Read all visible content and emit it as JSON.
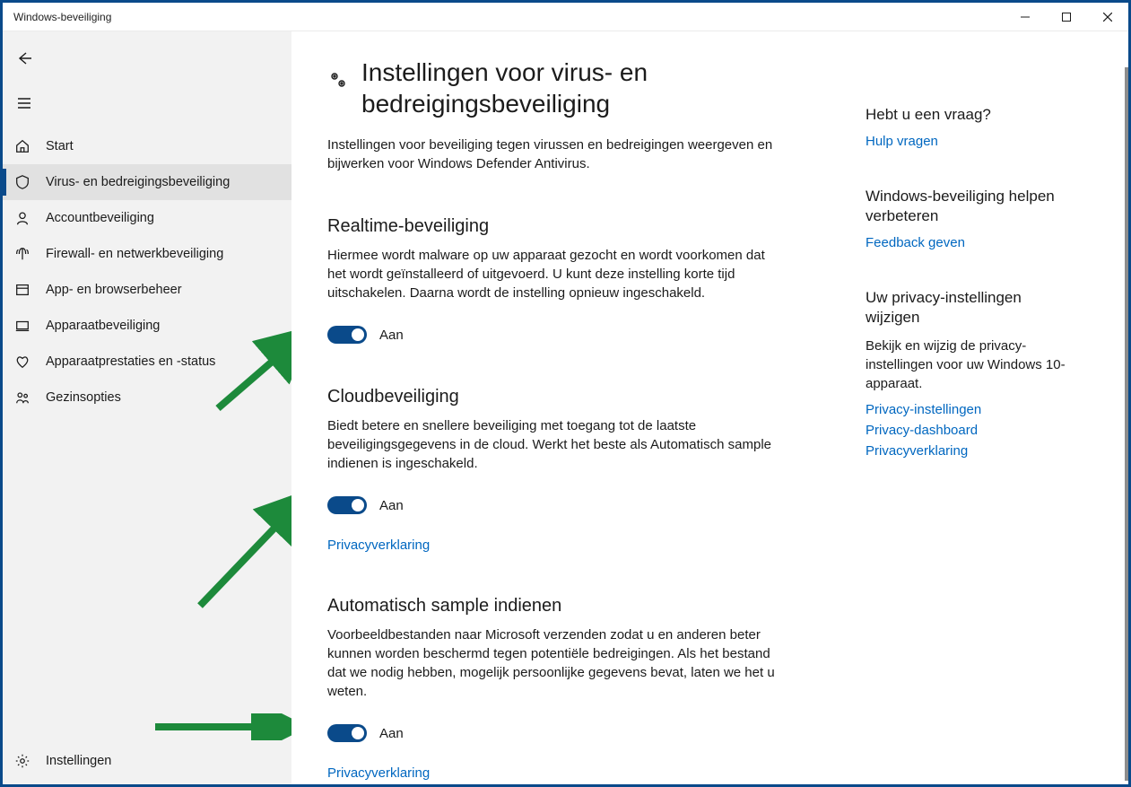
{
  "window": {
    "title": "Windows-beveiliging"
  },
  "sidebar": {
    "items": [
      {
        "label": "Start"
      },
      {
        "label": "Virus- en bedreigingsbeveiliging"
      },
      {
        "label": "Accountbeveiliging"
      },
      {
        "label": "Firewall- en netwerkbeveiliging"
      },
      {
        "label": "App- en browserbeheer"
      },
      {
        "label": "Apparaatbeveiliging"
      },
      {
        "label": "Apparaatprestaties en -status"
      },
      {
        "label": "Gezinsopties"
      }
    ],
    "settings_label": "Instellingen"
  },
  "main": {
    "page_title": "Instellingen voor virus- en bedreigingsbeveiliging",
    "page_desc": "Instellingen voor beveiliging tegen virussen en bedreigingen weergeven en bijwerken voor Windows Defender Antivirus.",
    "sections": [
      {
        "heading": "Realtime-beveiliging",
        "body": "Hiermee wordt malware op uw apparaat gezocht en wordt voorkomen dat het wordt geïnstalleerd of uitgevoerd. U kunt deze instelling korte tijd uitschakelen. Daarna wordt de instelling opnieuw ingeschakeld.",
        "toggle_state": "Aan",
        "privacy_link": null
      },
      {
        "heading": "Cloudbeveiliging",
        "body": "Biedt betere en snellere beveiliging met toegang tot de laatste beveiligingsgegevens in de cloud. Werkt het beste als Automatisch sample indienen is ingeschakeld.",
        "toggle_state": "Aan",
        "privacy_link": "Privacyverklaring"
      },
      {
        "heading": "Automatisch sample indienen",
        "body": "Voorbeeldbestanden naar Microsoft verzenden zodat u en anderen beter kunnen worden beschermd tegen potentiële bedreigingen. Als het bestand dat we nodig hebben, mogelijk persoonlijke gegevens bevat, laten we het u weten.",
        "toggle_state": "Aan",
        "privacy_link": "Privacyverklaring"
      }
    ]
  },
  "rightpane": {
    "help": {
      "heading": "Hebt u een vraag?",
      "link": "Hulp vragen"
    },
    "feedback": {
      "heading": "Windows-beveiliging helpen verbeteren",
      "link": "Feedback geven"
    },
    "privacy": {
      "heading": "Uw privacy-instellingen wijzigen",
      "body": "Bekijk en wijzig de privacy-instellingen voor uw Windows 10-apparaat.",
      "links": [
        "Privacy-instellingen",
        "Privacy-dashboard",
        "Privacyverklaring"
      ]
    }
  },
  "colors": {
    "accent": "#0a4a8a",
    "link": "#0067c0"
  }
}
